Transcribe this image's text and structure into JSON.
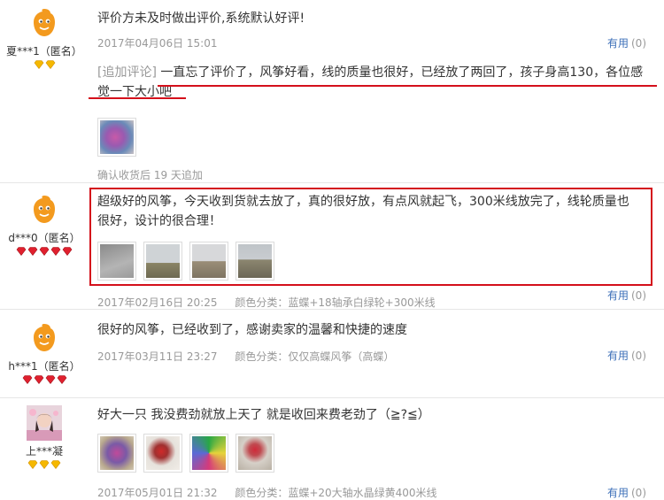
{
  "reviews": [
    {
      "user": "夏***1（匿名）",
      "gems": [
        "gold",
        "gold"
      ],
      "text": "评价方未及时做出评价,系统默认好评!",
      "date": "2017年04月06日 15:01",
      "useful_label": "有用",
      "useful_count": "(0)",
      "append_tag": "[追加评论]",
      "append_text": "一直忘了评价了，风筝好看，线的质量也很好，已经放了两回了，孩子身高130，各位感觉一下大小吧",
      "append_time": "确认收货后 19 天追加"
    },
    {
      "user": "d***0（匿名）",
      "gems": [
        "red",
        "red",
        "red",
        "red",
        "red"
      ],
      "text": "超级好的风筝，今天收到货就去放了，真的很好放，有点风就起飞，300米线放完了，线轮质量也很好，设计的很合理！",
      "date": "2017年02月16日 20:25",
      "color_label": "颜色分类：蓝蝶+18轴承白绿轮+300米线",
      "useful_label": "有用",
      "useful_count": "(0)"
    },
    {
      "user": "h***1（匿名）",
      "gems": [
        "red",
        "red",
        "red",
        "red"
      ],
      "text": "很好的风筝，已经收到了，感谢卖家的温馨和快捷的速度",
      "date": "2017年03月11日 23:27",
      "color_label": "颜色分类：仅仅高蝶风筝（高蝶）",
      "useful_label": "有用",
      "useful_count": "(0)"
    },
    {
      "user": "上***凝",
      "gems": [
        "gold",
        "gold",
        "gold"
      ],
      "text": "好大一只 我没费劲就放上天了 就是收回来费老劲了（≧?≦）",
      "date": "2017年05月01日 21:32",
      "color_label": "颜色分类：蓝蝶+20大轴水晶绿黄400米线",
      "useful_label": "有用",
      "useful_count": "(0)"
    }
  ],
  "colors": {
    "highlight_red": "#d4101b",
    "link_blue": "#3c6fb8",
    "meta_gray": "#999999",
    "gem_gold": "#f5b800",
    "gem_red": "#e0202e",
    "avatar_orange": "#f39a1e"
  }
}
